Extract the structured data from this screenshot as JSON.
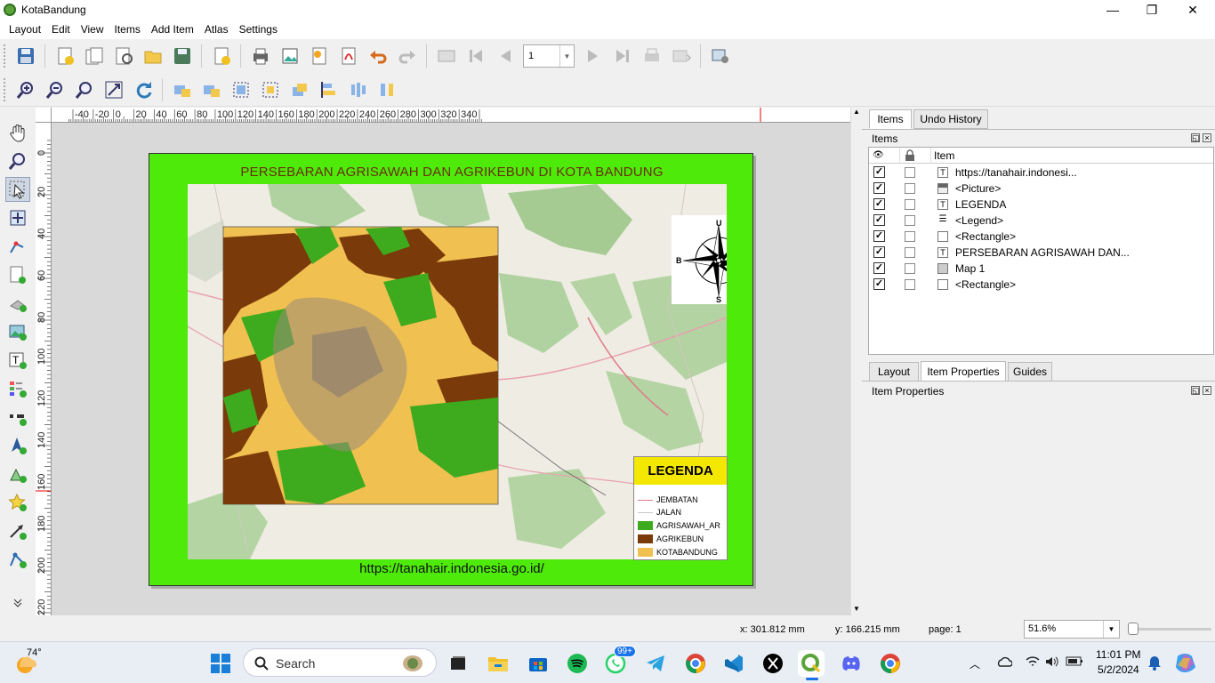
{
  "window": {
    "title": "KotaBandung",
    "minimize": "—",
    "maximize": "❐",
    "close": "✕"
  },
  "menu": [
    "Layout",
    "Edit",
    "View",
    "Items",
    "Add Item",
    "Atlas",
    "Settings"
  ],
  "toolbar": {
    "page_value": "1"
  },
  "rulers": {
    "h_ticks": [
      "-40",
      "-20",
      "0",
      "20",
      "40",
      "60",
      "80",
      "100",
      "120",
      "140",
      "160",
      "180",
      "200",
      "220",
      "240",
      "260",
      "280",
      "300",
      "320",
      "340"
    ],
    "v_ticks": [
      "0",
      "20",
      "40",
      "60",
      "80",
      "100",
      "120",
      "140",
      "160",
      "180",
      "200",
      "220"
    ]
  },
  "layout": {
    "title": "PERSEBARAN AGRISAWAH DAN AGRIKEBUN DI KOTA BANDUNG",
    "source_url": "https://tanahair.indonesia.go.id/",
    "compass": {
      "north": "U",
      "south": "S",
      "east": "T",
      "west": "B"
    },
    "legend": {
      "title": "LEGENDA",
      "items": [
        {
          "label": "JEMBATAN",
          "color": "#e07a8a",
          "kind": "line"
        },
        {
          "label": "JALAN",
          "color": "#c8c8c8",
          "kind": "line"
        },
        {
          "label": "AGRISAWAH_AR",
          "color": "#3eaa1e",
          "kind": "fill"
        },
        {
          "label": "AGRIKEBUN",
          "color": "#7a3a0a",
          "kind": "fill"
        },
        {
          "label": "KOTABANDUNG",
          "color": "#f0c050",
          "kind": "fill"
        }
      ]
    }
  },
  "panel": {
    "tabs_top": [
      "Items",
      "Undo History"
    ],
    "items_title": "Items",
    "column_item": "Item",
    "items": [
      {
        "label": "https://tanahair.indonesi...",
        "icon": "text-icon",
        "checked": "✓"
      },
      {
        "label": "<Picture>",
        "icon": "picture-icon",
        "checked": "✓"
      },
      {
        "label": "LEGENDA",
        "icon": "text-icon",
        "checked": "✓"
      },
      {
        "label": "<Legend>",
        "icon": "legend-icon",
        "checked": "✓"
      },
      {
        "label": "<Rectangle>",
        "icon": "rectangle-icon",
        "checked": "✓"
      },
      {
        "label": "PERSEBARAN AGRISAWAH DAN...",
        "icon": "text-icon",
        "checked": "✓"
      },
      {
        "label": "Map 1",
        "icon": "map-icon",
        "checked": "✓"
      },
      {
        "label": "<Rectangle>",
        "icon": "rectangle-icon",
        "checked": "✓"
      }
    ],
    "tabs_bottom": [
      "Layout",
      "Item Properties",
      "Guides"
    ],
    "props_title": "Item Properties"
  },
  "status": {
    "x": "x: 301.812 mm",
    "y": "y: 166.215 mm",
    "page": "page: 1",
    "zoom": "51.6%"
  },
  "taskbar": {
    "weather": "74°",
    "search_placeholder": "Search",
    "whatsapp_badge": "99+",
    "time": "11:01 PM",
    "date": "5/2/2024"
  }
}
